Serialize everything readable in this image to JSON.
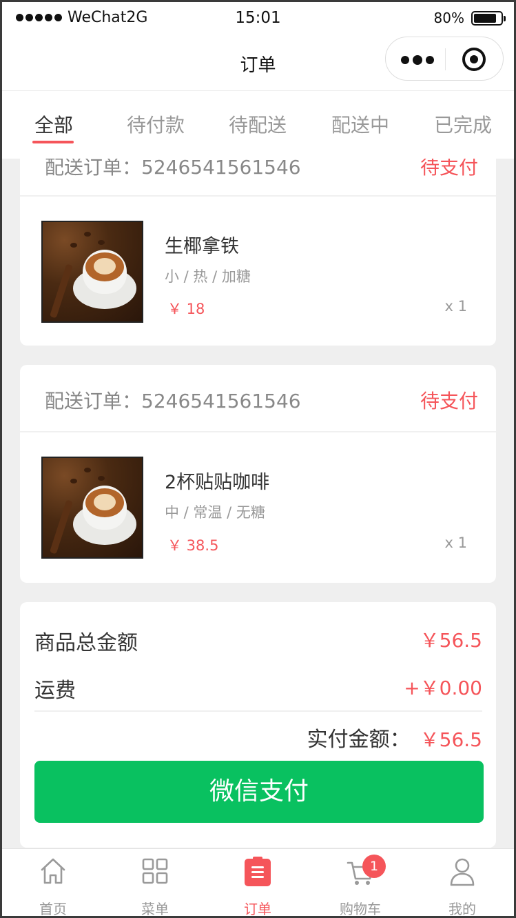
{
  "status_bar": {
    "carrier": "WeChat2G",
    "time": "15:01",
    "battery": "80%"
  },
  "nav": {
    "title": "订单"
  },
  "tabs": [
    {
      "label": "全部",
      "active": true
    },
    {
      "label": "待付款",
      "active": false
    },
    {
      "label": "待配送",
      "active": false
    },
    {
      "label": "配送中",
      "active": false
    },
    {
      "label": "已完成",
      "active": false
    }
  ],
  "orders": [
    {
      "order_label": "配送订单：5246541561546",
      "status": "待支付",
      "item": {
        "name": "生椰拿铁",
        "spec": "小 / 热 / 加糖",
        "price": "￥ 18",
        "qty": "x 1"
      }
    },
    {
      "order_label": "配送订单：5246541561546",
      "status": "待支付",
      "item": {
        "name": "2杯贴贴咖啡",
        "spec": "中 / 常温 / 无糖",
        "price": "￥ 38.5",
        "qty": "x 1"
      }
    }
  ],
  "summary": {
    "goods_total_label": "商品总金额",
    "goods_total_value": "￥56.5",
    "shipping_label": "运费",
    "shipping_value": "+￥0.00",
    "paid_label": "实付金额：",
    "paid_value": "￥56.5",
    "pay_button": "微信支付"
  },
  "tabbar": [
    {
      "label": "首页",
      "icon": "home-icon"
    },
    {
      "label": "菜单",
      "icon": "grid-icon"
    },
    {
      "label": "订单",
      "icon": "order-icon",
      "active": true
    },
    {
      "label": "购物车",
      "icon": "cart-icon",
      "badge": "1"
    },
    {
      "label": "我的",
      "icon": "user-icon"
    }
  ],
  "colors": {
    "accent": "#f5555a",
    "wechat_green": "#09c160"
  }
}
